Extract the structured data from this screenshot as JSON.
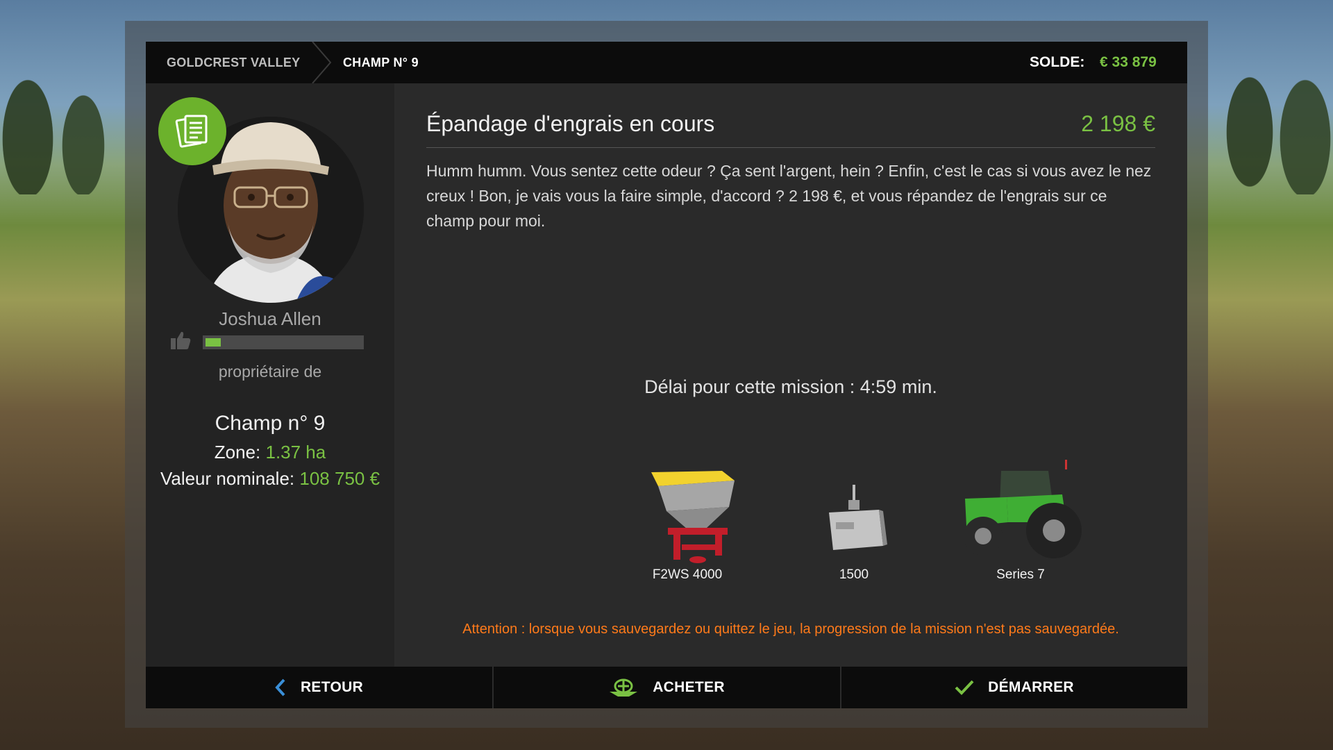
{
  "breadcrumb": {
    "farm": "GOLDCREST VALLEY",
    "field": "CHAMP N° 9"
  },
  "balance": {
    "label": "SOLDE:",
    "value": "€ 33 879"
  },
  "npc": {
    "name": "Joshua Allen",
    "reputation_fraction": 0.1,
    "owner_label": "propriétaire de"
  },
  "field": {
    "name": "Champ n° 9",
    "zone_label": "Zone: ",
    "zone_value": "1.37 ha",
    "value_label": "Valeur nominale: ",
    "value_value": "108 750 €"
  },
  "mission": {
    "title": "Épandage d'engrais en cours",
    "reward": "2 198 €",
    "description": "Humm humm. Vous sentez cette odeur ? Ça sent l'argent, hein ? Enfin, c'est le cas si vous avez le nez creux ! Bon, je vais vous la faire simple, d'accord ? 2 198 €, et vous répandez de l'engrais sur ce champ pour moi.",
    "timer": "Délai pour cette mission : 4:59 min.",
    "vehicles": [
      {
        "label": "F2WS 4000",
        "icon": "fertilizer-spreader-icon"
      },
      {
        "label": "1500",
        "icon": "weight-icon"
      },
      {
        "label": "Series 7",
        "icon": "tractor-icon"
      }
    ],
    "warning": "Attention : lorsque vous sauvegardez ou quittez le jeu, la progression de la mission n'est pas sauvegardée."
  },
  "actions": {
    "back": "RETOUR",
    "buy": "ACHETER",
    "start": "DÉMARRER"
  },
  "colors": {
    "accent_green": "#7ac143",
    "warning_orange": "#ff7a1a",
    "badge_green": "#6cb22c"
  }
}
